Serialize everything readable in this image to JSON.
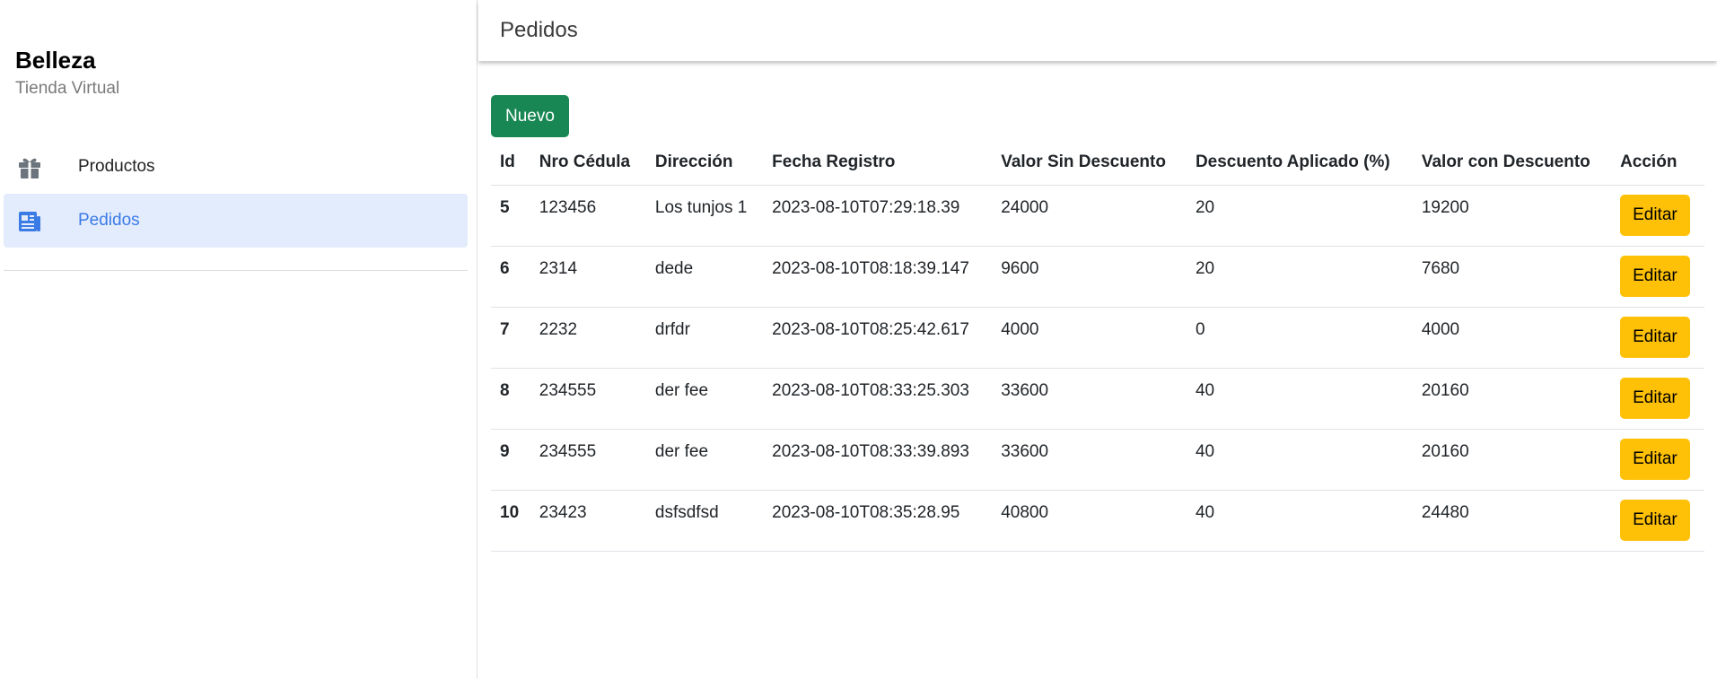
{
  "brand": {
    "title": "Belleza",
    "subtitle": "Tienda Virtual"
  },
  "sidebar": {
    "items": [
      {
        "label": "Productos",
        "icon": "gift-icon",
        "active": false
      },
      {
        "label": "Pedidos",
        "icon": "newspaper-icon",
        "active": true
      }
    ]
  },
  "header": {
    "title": "Pedidos"
  },
  "toolbar": {
    "new_label": "Nuevo"
  },
  "table": {
    "columns": [
      "Id",
      "Nro Cédula",
      "Dirección",
      "Fecha Registro",
      "Valor Sin Descuento",
      "Descuento Aplicado (%)",
      "Valor con Descuento",
      "Acción"
    ],
    "action_label": "Editar",
    "rows": [
      {
        "id": "5",
        "cedula": "123456",
        "direccion": "Los tunjos 1",
        "fecha": "2023-08-10T07:29:18.39",
        "valor_sin": "24000",
        "descuento": "20",
        "valor_con": "19200"
      },
      {
        "id": "6",
        "cedula": "2314",
        "direccion": "dede",
        "fecha": "2023-08-10T08:18:39.147",
        "valor_sin": "9600",
        "descuento": "20",
        "valor_con": "7680"
      },
      {
        "id": "7",
        "cedula": "2232",
        "direccion": "drfdr",
        "fecha": "2023-08-10T08:25:42.617",
        "valor_sin": "4000",
        "descuento": "0",
        "valor_con": "4000"
      },
      {
        "id": "8",
        "cedula": "234555",
        "direccion": "der fee",
        "fecha": "2023-08-10T08:33:25.303",
        "valor_sin": "33600",
        "descuento": "40",
        "valor_con": "20160"
      },
      {
        "id": "9",
        "cedula": "234555",
        "direccion": "der fee",
        "fecha": "2023-08-10T08:33:39.893",
        "valor_sin": "33600",
        "descuento": "40",
        "valor_con": "20160"
      },
      {
        "id": "10",
        "cedula": "23423",
        "direccion": "dsfsdfsd",
        "fecha": "2023-08-10T08:35:28.95",
        "valor_sin": "40800",
        "descuento": "40",
        "valor_con": "24480"
      }
    ]
  },
  "colors": {
    "primary_success": "#198754",
    "warning": "#ffc107",
    "active_nav_bg": "#e3ecfc",
    "active_nav_text": "#3b7be6",
    "icon_gray": "#6c757d"
  }
}
